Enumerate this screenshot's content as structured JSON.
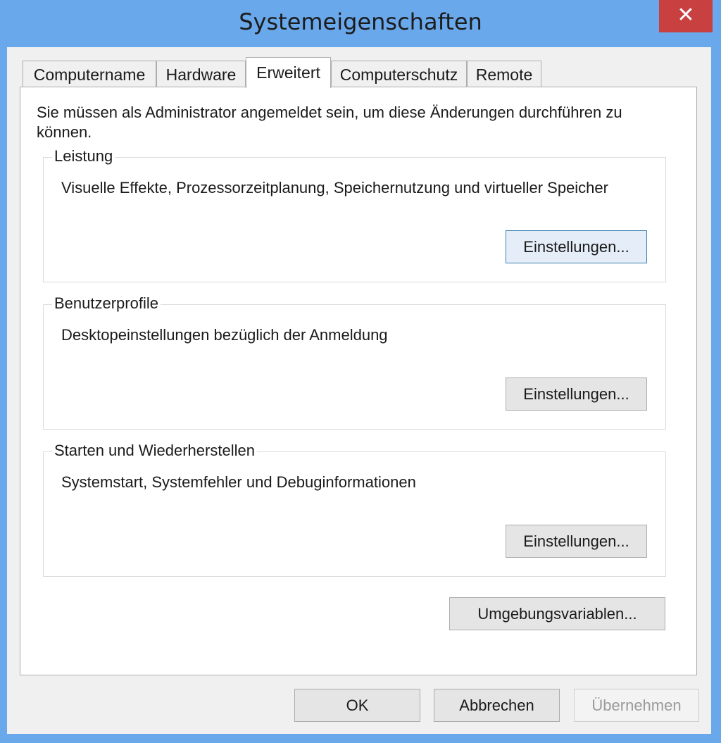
{
  "window": {
    "title": "Systemeigenschaften",
    "close_label": "✕"
  },
  "tabs": [
    {
      "label": "Computername",
      "active": false
    },
    {
      "label": "Hardware",
      "active": false
    },
    {
      "label": "Erweitert",
      "active": true
    },
    {
      "label": "Computerschutz",
      "active": false
    },
    {
      "label": "Remote",
      "active": false
    }
  ],
  "panel": {
    "intro": "Sie müssen als Administrator angemeldet sein, um diese Änderungen durchführen zu können.",
    "groups": [
      {
        "label": "Leistung",
        "description": "Visuelle Effekte, Prozessorzeitplanung, Speichernutzung und virtueller Speicher",
        "button": "Einstellungen..."
      },
      {
        "label": "Benutzerprofile",
        "description": "Desktopeinstellungen bezüglich der Anmeldung",
        "button": "Einstellungen..."
      },
      {
        "label": "Starten und Wiederherstellen",
        "description": "Systemstart, Systemfehler und Debuginformationen",
        "button": "Einstellungen..."
      }
    ],
    "env_button": "Umgebungsvariablen..."
  },
  "footer": {
    "ok": "OK",
    "cancel": "Abbrechen",
    "apply": "Übernehmen"
  },
  "colors": {
    "frame": "#6aa8ec",
    "close": "#c8403f",
    "default_button_border": "#3c7fb1"
  }
}
